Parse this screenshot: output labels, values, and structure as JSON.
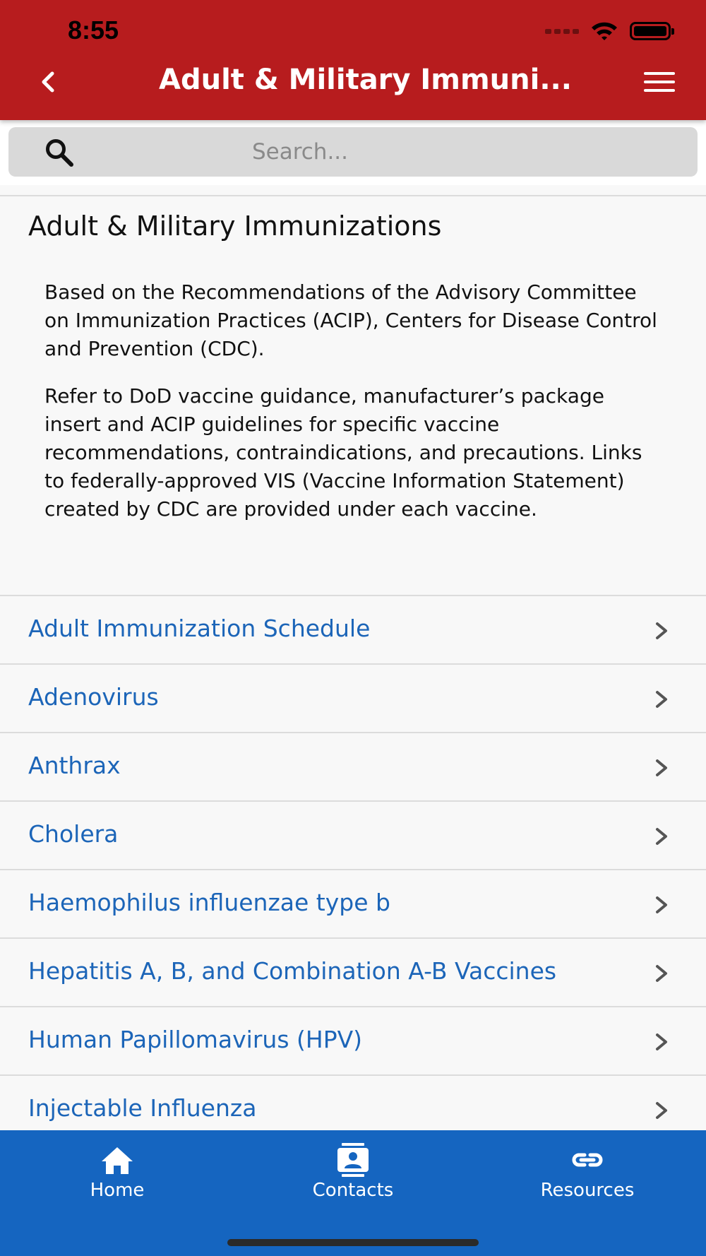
{
  "status_bar": {
    "time": "8:55"
  },
  "header": {
    "title": "Adult & Military Immuni..."
  },
  "search": {
    "placeholder": "Search..."
  },
  "page": {
    "title": "Adult & Military Immunizations",
    "paragraphs": [
      "Based on the Recommendations of the Advisory Committee on Immunization Practices (ACIP), Centers for Disease Control and Prevention (CDC).",
      "Refer to DoD vaccine guidance, manufacturer’s package insert and ACIP guidelines for specific vaccine recommendations, contraindications, and precautions. Links to federally-approved VIS (Vaccine Information Statement) created by CDC are provided under each vaccine."
    ]
  },
  "list": {
    "items": [
      {
        "label": "Adult Immunization Schedule"
      },
      {
        "label": "Adenovirus"
      },
      {
        "label": "Anthrax"
      },
      {
        "label": "Cholera"
      },
      {
        "label": "Haemophilus influenzae type b"
      },
      {
        "label": "Hepatitis A, B, and Combination A-B Vaccines"
      },
      {
        "label": "Human Papillomavirus (HPV)"
      },
      {
        "label": "Injectable Influenza"
      }
    ]
  },
  "tabbar": {
    "tabs": [
      {
        "label": "Home",
        "icon": "home-icon"
      },
      {
        "label": "Contacts",
        "icon": "contacts-icon"
      },
      {
        "label": "Resources",
        "icon": "link-icon"
      }
    ]
  },
  "colors": {
    "header_bg": "#b71c1e",
    "link": "#1c65b8",
    "tabbar_bg": "#1565c0"
  }
}
